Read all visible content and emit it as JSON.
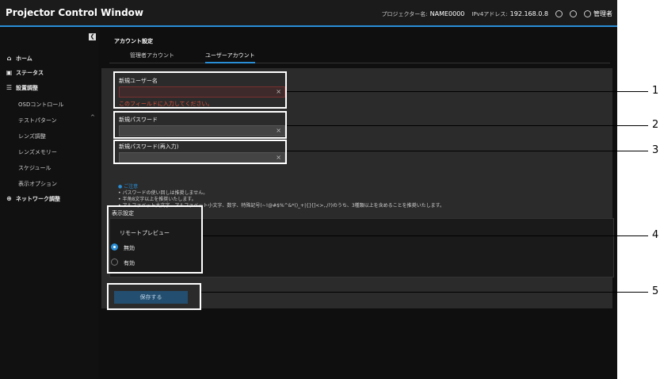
{
  "header": {
    "app_title": "Projector Control Window",
    "projector_name_label": "プロジェクター名:",
    "projector_name": "NAME0000",
    "ipv4_label": "IPv4アドレス:",
    "ipv4": "192.168.0.8",
    "user": "管理者"
  },
  "sidebar": {
    "collapse_glyph": "❮",
    "items": [
      {
        "label": "ホーム"
      },
      {
        "label": "ステータス"
      },
      {
        "label": "設置調整"
      },
      {
        "label": "OSDコントロール"
      },
      {
        "label": "テストパターン"
      },
      {
        "label": "レンズ調整"
      },
      {
        "label": "レンズメモリー"
      },
      {
        "label": "スケジュール"
      },
      {
        "label": "表示オプション"
      },
      {
        "label": "ネットワーク調整"
      }
    ]
  },
  "main": {
    "section_title": "アカウント設定",
    "tabs": [
      {
        "label": "管理者アカウント"
      },
      {
        "label": "ユーザーアカウント"
      }
    ],
    "fields": [
      {
        "label": "新規ユーザー名",
        "value": "",
        "error": "このフィールドに入力してください。"
      },
      {
        "label": "新規パスワード",
        "value": ""
      },
      {
        "label": "新規パスワード(再入力)",
        "value": ""
      }
    ],
    "notes": {
      "head": "ご注意",
      "items": [
        "パスワードの使い回しは推奨しません。",
        "半角8文字以上を推奨いたします。",
        "アルファベット大文字、アルファベット小文字、数字、特殊記号(~!@#$%^&*()_+|{}[]<>,./?)のうち、3種類以上を含めることを推奨いたします。"
      ]
    },
    "display_settings": {
      "title": "表示設定",
      "remote_preview_label": "リモートプレビュー",
      "options": [
        {
          "label": "無効",
          "selected": true
        },
        {
          "label": "有効",
          "selected": false
        }
      ]
    },
    "save_label": "保存する"
  },
  "callouts": [
    "1",
    "2",
    "3",
    "4",
    "5"
  ],
  "colors": {
    "accent": "#2a8ed6",
    "error": "#e0513a",
    "background": "#0f0f0f"
  }
}
